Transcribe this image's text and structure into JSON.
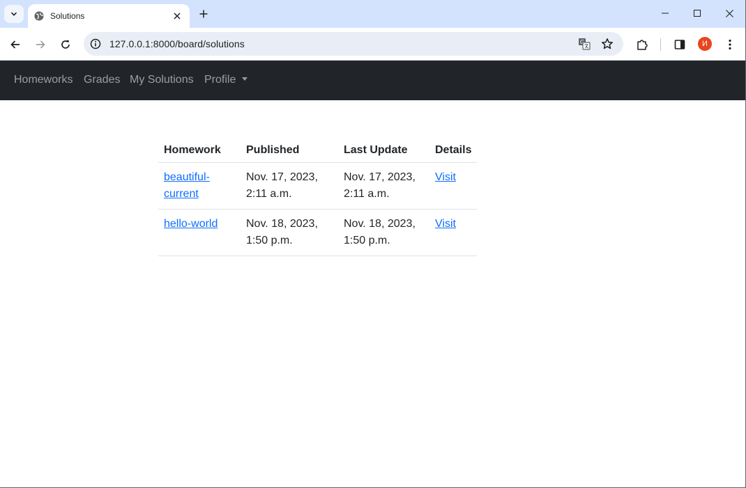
{
  "browser": {
    "tab_title": "Solutions",
    "url": "127.0.0.1:8000/board/solutions",
    "avatar_letter": "И"
  },
  "navbar": {
    "items": [
      {
        "label": "Homeworks"
      },
      {
        "label": "Grades"
      },
      {
        "label": "My Solutions"
      },
      {
        "label": "Profile"
      }
    ]
  },
  "table": {
    "headers": [
      "Homework",
      "Published",
      "Last Update",
      "Details"
    ],
    "rows": [
      {
        "homework_1": "beautiful-",
        "homework_2": "current",
        "published_1": "Nov. 17, 2023,",
        "published_2": "2:11 a.m.",
        "updated_1": "Nov. 17, 2023,",
        "updated_2": "2:11 a.m.",
        "details": "Visit"
      },
      {
        "homework_1": "hello-world",
        "homework_2": "",
        "published_1": "Nov. 18, 2023,",
        "published_2": "1:50 p.m.",
        "updated_1": "Nov. 18, 2023,",
        "updated_2": "1:50 p.m.",
        "details": "Visit"
      }
    ]
  },
  "colors": {
    "navbar_bg": "#212529",
    "link": "#0d6efd",
    "tabstrip_bg": "#d3e3fd"
  }
}
